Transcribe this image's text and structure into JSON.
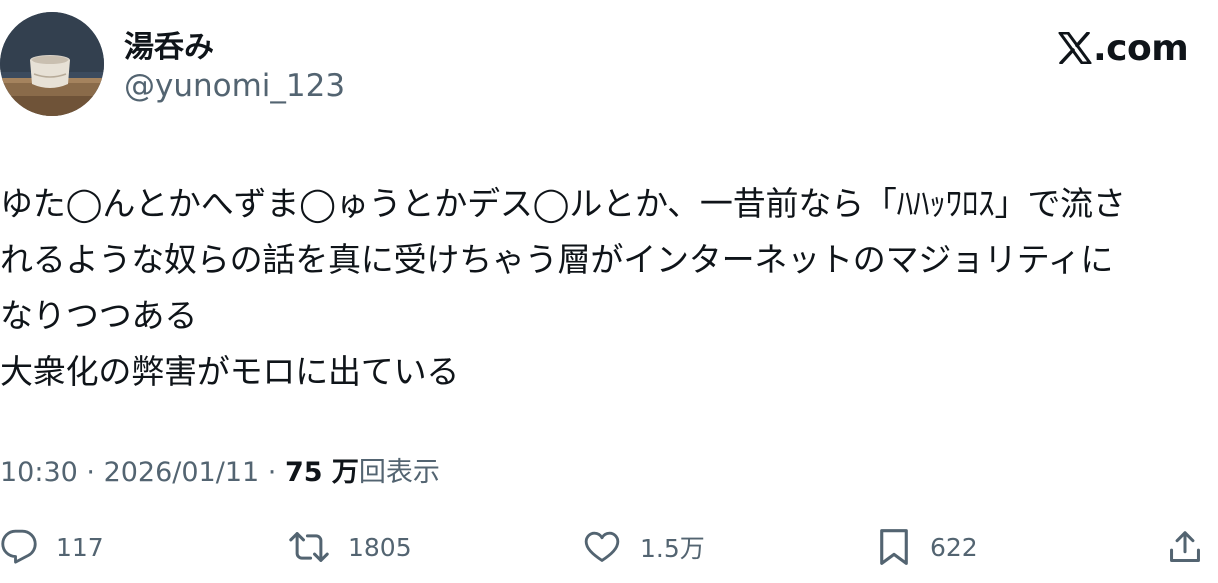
{
  "author": {
    "display_name": "湯呑み",
    "handle": "@yunomi_123"
  },
  "brand": {
    "domain": ".com"
  },
  "tweet": {
    "lines": [
      "ゆた◯んとかへずま◯ゅうとかデス◯ルとか、一昔前なら「ﾊﾊｯﾜﾛｽ」で流さ",
      "れるような奴らの話を真に受けちゃう層がインターネットのマジョリティに",
      "なりつつある",
      "大衆化の弊害がモロに出ている"
    ]
  },
  "meta": {
    "time": "10:30",
    "separator": " · ",
    "date": "2026/01/11",
    "views_count": "75 万",
    "views_label": "回表示"
  },
  "actions": {
    "reply_count": "117",
    "retweet_count": "1805",
    "like_count": "1.5万",
    "bookmark_count": "622"
  },
  "colors": {
    "text": "#0f1419",
    "secondary": "#536471",
    "background": "#ffffff"
  }
}
